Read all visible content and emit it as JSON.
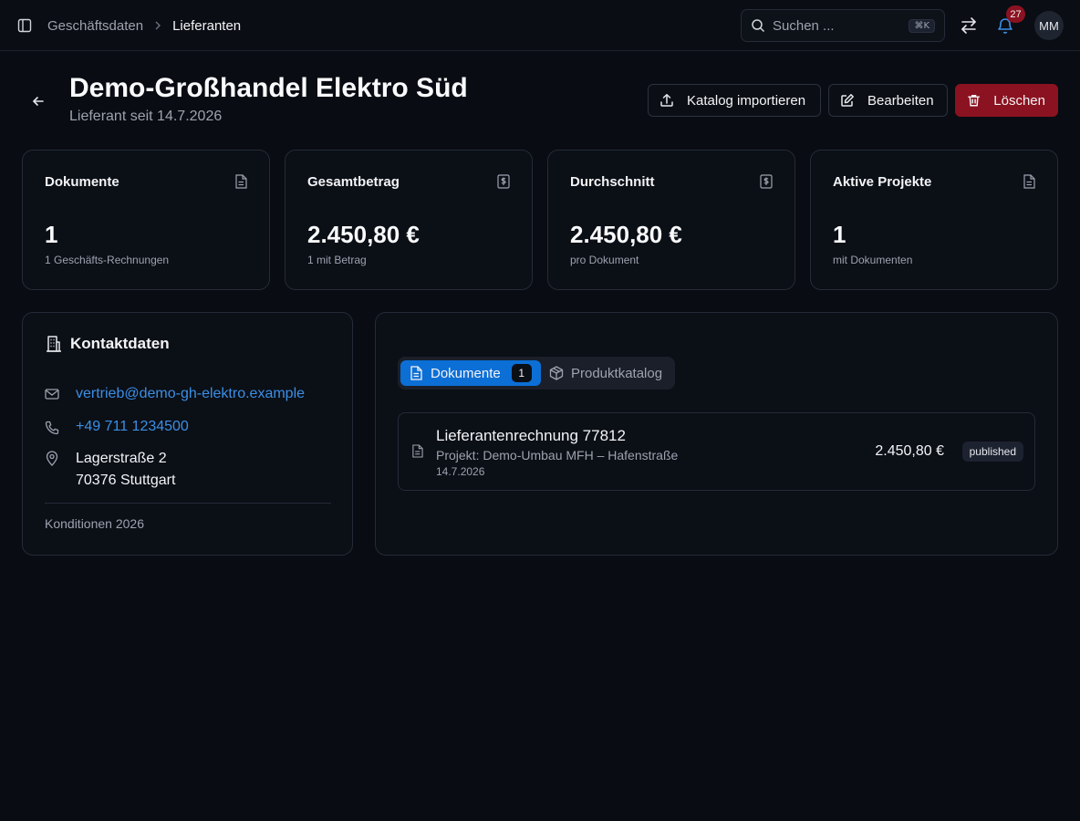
{
  "topbar": {
    "breadcrumb": {
      "parent": "Geschäftsdaten",
      "current": "Lieferanten"
    },
    "search": {
      "placeholder": "Suchen ...",
      "shortcut": "⌘K"
    },
    "notifications_count": "27",
    "avatar_initials": "MM"
  },
  "header": {
    "title": "Demo-Großhandel Elektro Süd",
    "subtitle": "Lieferant seit 14.7.2026",
    "actions": {
      "import_label": "Katalog importieren",
      "edit_label": "Bearbeiten",
      "delete_label": "Löschen"
    }
  },
  "stats": [
    {
      "title": "Dokumente",
      "value": "1",
      "caption": "1 Geschäfts-Rechnungen",
      "icon": "file-text-icon"
    },
    {
      "title": "Gesamtbetrag",
      "value": "2.450,80 €",
      "caption": "1 mit Betrag",
      "icon": "receipt-icon"
    },
    {
      "title": "Durchschnitt",
      "value": "2.450,80 €",
      "caption": "pro Dokument",
      "icon": "receipt-icon"
    },
    {
      "title": "Aktive Projekte",
      "value": "1",
      "caption": "mit Dokumenten",
      "icon": "file-text-icon"
    }
  ],
  "contact": {
    "title": "Kontaktdaten",
    "email": "vertrieb@demo-gh-elektro.example",
    "phone": "+49 711 1234500",
    "address_line1": "Lagerstraße 2",
    "address_line2": "70376 Stuttgart",
    "conditions": "Konditionen 2026"
  },
  "documents": {
    "tabs": {
      "active_label": "Dokumente",
      "active_count": "1",
      "inactive_label": "Produktkatalog"
    },
    "items": [
      {
        "title": "Lieferantenrechnung 77812",
        "project": "Projekt: Demo-Umbau MFH – Hafenstraße",
        "date": "14.7.2026",
        "amount": "2.450,80 €",
        "status": "published"
      }
    ]
  },
  "colors": {
    "background": "#090c12",
    "accent": "#0c6fd6",
    "link": "#3b8fe6",
    "danger": "#8b1220"
  }
}
